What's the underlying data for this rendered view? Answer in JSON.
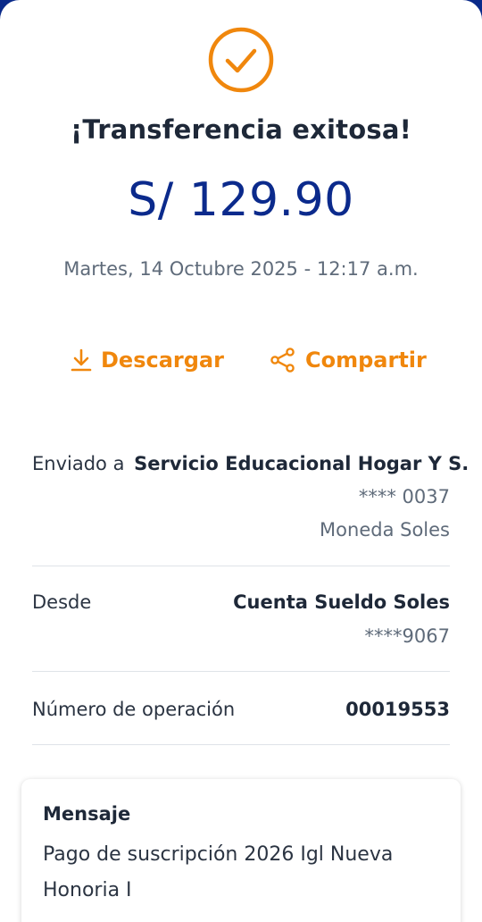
{
  "status": {
    "title": "¡Transferencia exitosa!",
    "amount": "S/ 129.90",
    "datetime": "Martes, 14 Octubre 2025 - 12:17 a.m.",
    "accent_color": "#f0870d",
    "brand_color": "#0b2a8c"
  },
  "actions": {
    "download_label": "Descargar",
    "share_label": "Compartir"
  },
  "details": {
    "sent_to_label": "Enviado a",
    "sent_to_name": "Servicio Educacional Hogar Y S.",
    "sent_to_account": "**** 0037",
    "sent_to_currency": "Moneda Soles",
    "from_label": "Desde",
    "from_account_name": "Cuenta Sueldo Soles",
    "from_account_number": "****9067",
    "operation_label": "Número de operación",
    "operation_number": "00019553"
  },
  "message": {
    "title": "Mensaje",
    "body": "Pago de suscripción 2026 Igl Nueva Honoria I"
  }
}
